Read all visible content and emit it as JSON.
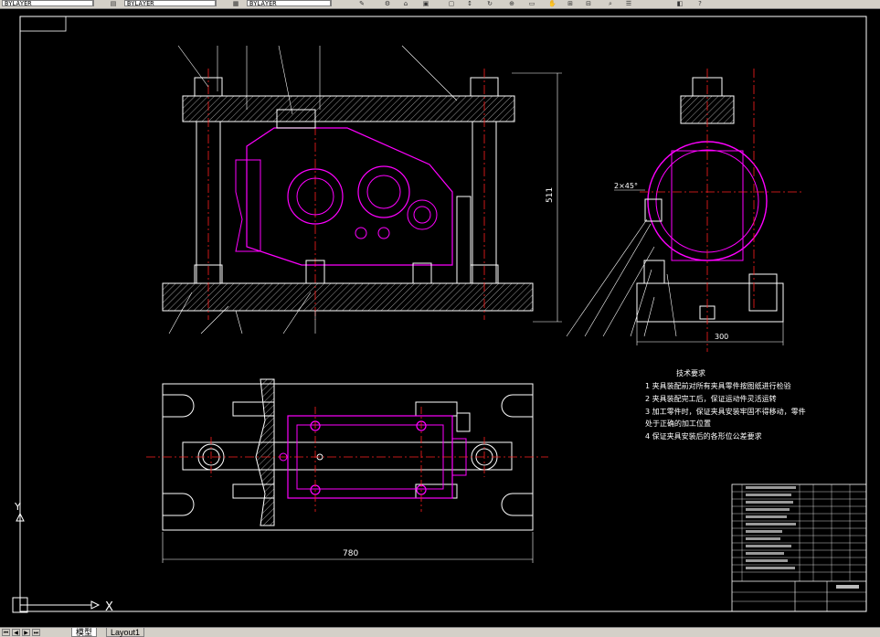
{
  "toolbar": {
    "combo1": "BYLAYER",
    "combo2": "BYLAYER",
    "combo3": "BYLAYER",
    "icons": [
      "layer-icon",
      "linetype-icon",
      "lineweight-icon",
      "brush-icon",
      "properties-icon",
      "link-icon",
      "download-icon",
      "refresh-icon",
      "zoom-icon",
      "window-icon",
      "arrow-icon",
      "help-icon"
    ]
  },
  "drawing": {
    "dim_height": "511",
    "dim_width_side": "300",
    "dim_width_plan": "780",
    "annotation_chamfer": "2×45°",
    "tech_req_title": "技术要求",
    "tech_req_items": [
      "1  夹具装配前对所有夹具零件按图纸进行检验",
      "2  夹具装配完工后，保证运动件灵活运转",
      "3  加工零件时，保证夹具安装牢固不得移动，零件",
      "    处于正确的加工位置",
      "4  保证夹具安装后的各形位公差要求"
    ]
  },
  "ucs": {
    "x_label": "X",
    "y_label": "Y"
  },
  "layout_tabs": {
    "model_label": "模型",
    "layout1_label": "Layout1"
  }
}
